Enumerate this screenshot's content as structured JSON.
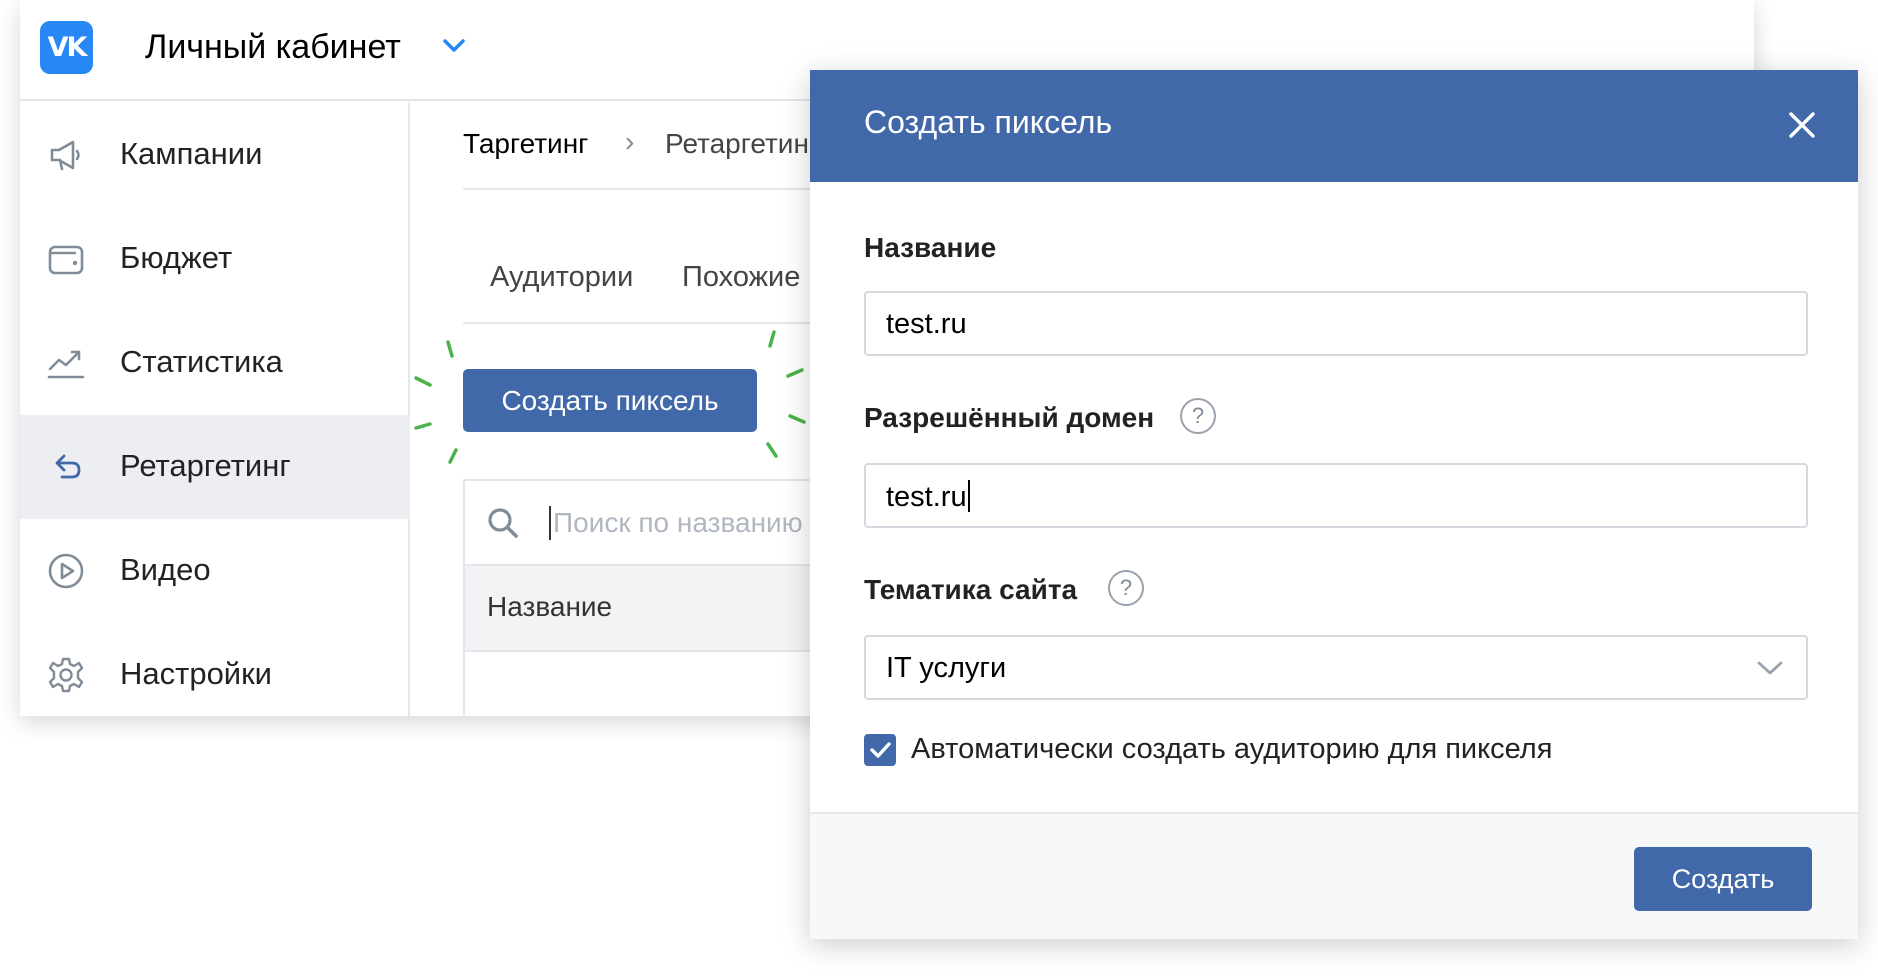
{
  "header": {
    "logo_text": "VK",
    "title": "Личный кабинет"
  },
  "sidebar": {
    "items": [
      {
        "label": "Кампании",
        "icon": "megaphone-icon"
      },
      {
        "label": "Бюджет",
        "icon": "wallet-icon"
      },
      {
        "label": "Статистика",
        "icon": "chart-icon"
      },
      {
        "label": "Ретаргетинг",
        "icon": "undo-arrow-icon",
        "active": true
      },
      {
        "label": "Видео",
        "icon": "play-circle-icon"
      },
      {
        "label": "Настройки",
        "icon": "gear-icon"
      }
    ]
  },
  "breadcrumb": {
    "items": [
      "Таргетинг",
      "Ретаргетинг"
    ],
    "separator": "›"
  },
  "tabs": [
    "Аудитории",
    "Похожие"
  ],
  "main": {
    "create_pixel_button": "Создать пиксель",
    "search_placeholder": "Поиск по названию",
    "table_header": "Название"
  },
  "modal": {
    "title": "Создать пиксель",
    "fields": {
      "name": {
        "label": "Название",
        "value": "test.ru"
      },
      "domain": {
        "label": "Разрешённый домен",
        "value": "test.ru"
      },
      "topic": {
        "label": "Тематика сайта",
        "value": "IT услуги"
      }
    },
    "help_symbol": "?",
    "checkbox": {
      "label": "Автоматически создать аудиторию для пикселя",
      "checked": true
    },
    "submit_button": "Создать"
  },
  "colors": {
    "accent": "#4168a8",
    "vk_logo": "#2787f5",
    "sidebar_active": "#eceef2",
    "highlight_sparks": "#4bb34b"
  }
}
